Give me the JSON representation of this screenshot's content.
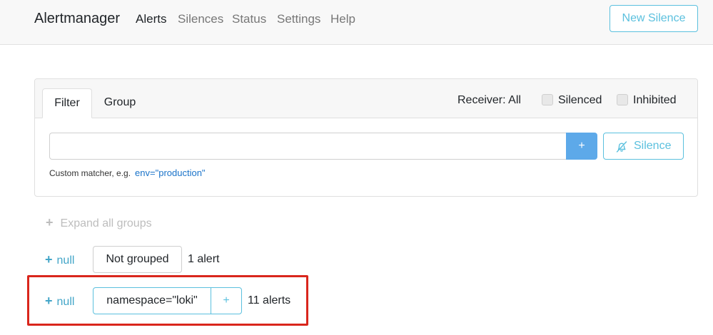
{
  "navbar": {
    "brand": "Alertmanager",
    "links": [
      "Alerts",
      "Silences",
      "Status",
      "Settings",
      "Help"
    ],
    "new_silence": "New Silence"
  },
  "filter_card": {
    "tabs": [
      "Filter",
      "Group"
    ],
    "receiver": "Receiver: All",
    "checkboxes": [
      "Silenced",
      "Inhibited"
    ],
    "input_value": "",
    "plus_label": "+",
    "silence_button": "Silence",
    "help_text": "Custom matcher, e.g.",
    "help_example": "env=\"production\""
  },
  "groups": {
    "expand_all": "Expand all groups",
    "expand_symbol": "+",
    "items": [
      {
        "toggle": "null",
        "label": "Not grouped",
        "count": "1 alert"
      },
      {
        "toggle": "null",
        "label": "namespace=\"loki\"",
        "add": "+",
        "count": "11 alerts"
      }
    ]
  },
  "colors": {
    "accent": "#5bc0de",
    "primary": "#5da9e9",
    "highlight": "#d9261c"
  }
}
